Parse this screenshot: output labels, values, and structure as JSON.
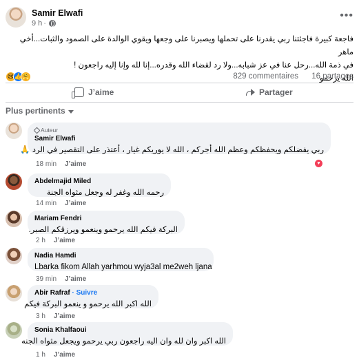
{
  "post": {
    "author": "Samir Elwafi",
    "time": "9 h",
    "time_separator": "·",
    "more_icon": "more-horizontal-icon",
    "privacy_icon": "globe-icon",
    "text_line1": "فاجعة كبيرة فاجئتنا ربي يقدرنا على تحملها ويصبرنا على وجعها ويقوي الوالدة على الصمود والثبات...أخي ماهر",
    "text_line2": "في ذمة الله...رحل عنا في عز شبابه...ولا رد لقضاء الله وقدره...إنا لله وإنا إليه راجعون !",
    "text_line3": "الله يرحمو",
    "reactions": [
      "sad-reaction-icon",
      "like-reaction-icon",
      "care-reaction-icon"
    ],
    "comments_count": "829 commentaires",
    "shares_count": "16 partages"
  },
  "actions": {
    "like_label": "J’aime",
    "share_label": "Partager"
  },
  "sort": {
    "label": "Plus pertinents"
  },
  "comments": [
    {
      "author": "Samir Elwafi",
      "badge": "Auteur",
      "text": "ربي يفضلكم ويحفظكم وعظم الله أجركم ، الله لا يوريكم غيار ، أعتذر على التقصير في الرد 🙏",
      "time": "18 min",
      "like": "J’aime",
      "reaction": "love-reaction-icon"
    },
    {
      "author": "Abdelmajid Miled",
      "text": "رحمه الله وغفر له وجعل مثواه الجنة",
      "time": "14 min",
      "like": "J’aime"
    },
    {
      "author": "Mariam Fendri",
      "text": "البركة فيكم الله يرحمو وينعمو ويرزقكم الصبر.",
      "time": "2 h",
      "like": "J’aime"
    },
    {
      "author": "Nadia Hamdi",
      "text": "Lbarka fikom Allah yarhmou wyja3al me2weh ljana",
      "time": "39 min",
      "like": "J’aime"
    },
    {
      "author": "Abir Rafraf",
      "follow_sep": " · ",
      "follow": "Suivre",
      "text": "الله اكبر الله يرحمو و ينعمو البركة فيكم",
      "time": "3 h",
      "like": "J’aime"
    },
    {
      "author": "Sonia Khalfaoui",
      "text": "الله اكبر وان لله وان اليه راجعون ربي يرحمو ويجعل مثواه الجنه",
      "time": "1 h",
      "like": "J’aime"
    }
  ],
  "colors": {
    "text": "#050505",
    "secondary": "#65676b",
    "bubble": "#f0f2f5",
    "link": "#1877f2",
    "love": "#f33e58",
    "divider": "#ced0d4"
  }
}
